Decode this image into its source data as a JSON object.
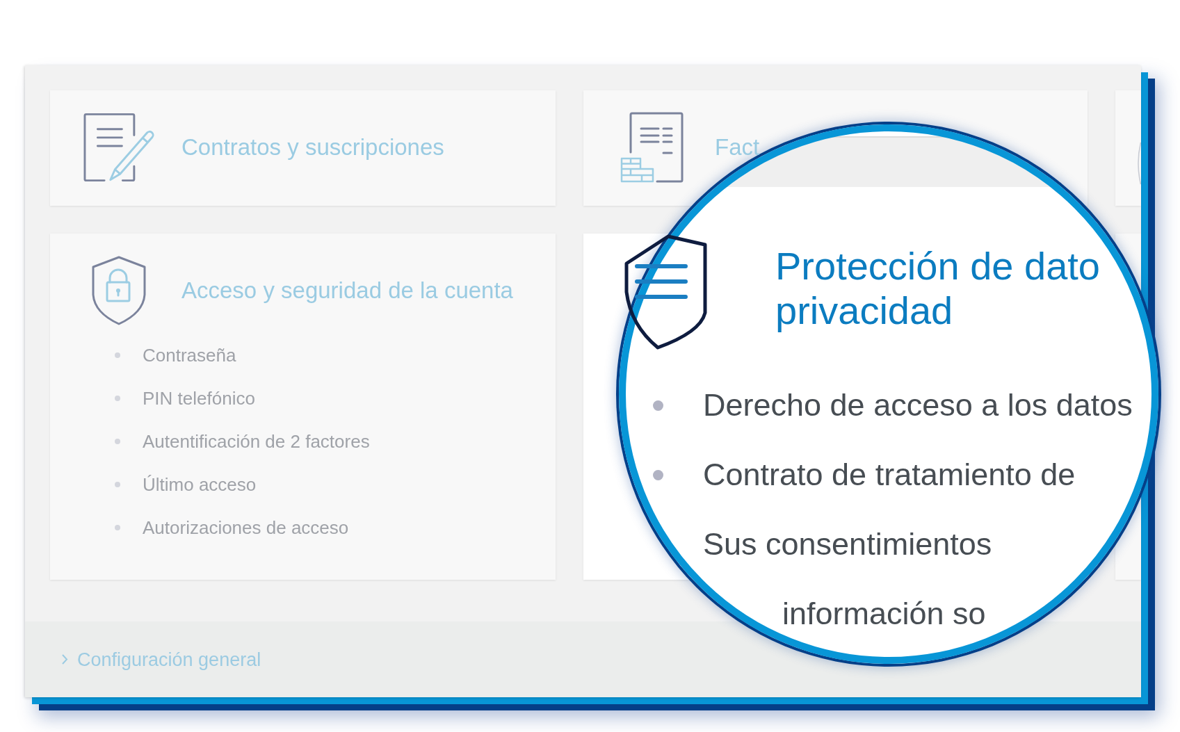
{
  "cards": [
    {
      "kind": "contracts",
      "title": "Contratos y suscripciones"
    },
    {
      "kind": "billing",
      "title": "Fact"
    },
    {
      "kind": "clipped"
    },
    {
      "kind": "security",
      "title": "Acceso y seguridad de la cuenta",
      "items": [
        "Contraseña",
        "PIN telefónico",
        "Autentificación de 2 factores",
        "Último acceso",
        "Autorizaciones de acceso"
      ]
    },
    {
      "kind": "magnified"
    },
    {
      "kind": "blank"
    }
  ],
  "magnifier": {
    "title_lines": [
      "Protección de dato",
      "privacidad"
    ],
    "items": [
      {
        "kind": "bulleted",
        "text": "Derecho de acceso a los datos"
      },
      {
        "kind": "bulleted",
        "text": "Contrato de tratamiento de"
      },
      {
        "kind": "plain",
        "text": "Sus consentimientos"
      },
      {
        "kind": "cut",
        "text": "información so"
      }
    ]
  },
  "footer": {
    "link": "Configuración general"
  }
}
